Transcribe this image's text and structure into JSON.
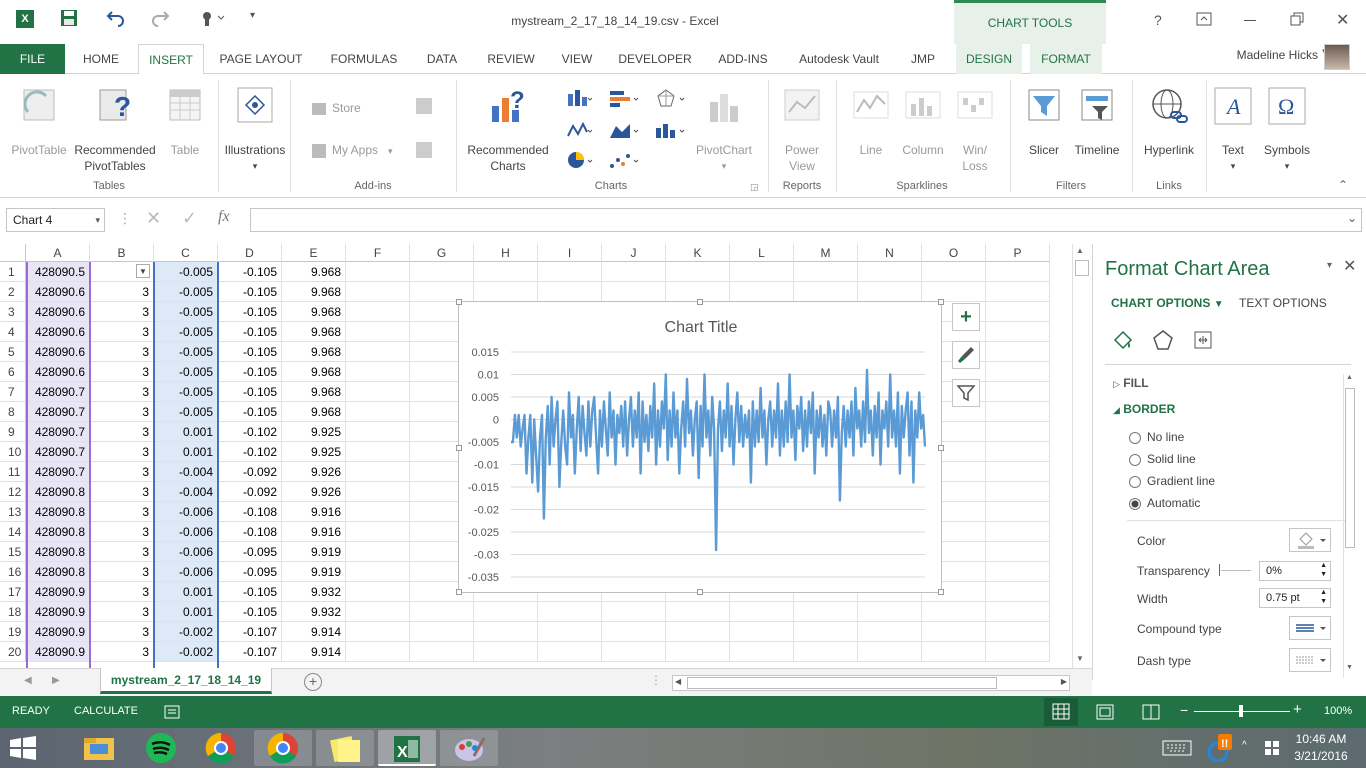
{
  "window": {
    "title": "mystream_2_17_18_14_19.csv - Excel",
    "chart_tools_label": "CHART TOOLS",
    "help": "?",
    "user": "Madeline Hicks"
  },
  "tabs": [
    "FILE",
    "HOME",
    "INSERT",
    "PAGE LAYOUT",
    "FORMULAS",
    "DATA",
    "REVIEW",
    "VIEW",
    "DEVELOPER",
    "ADD-INS",
    "Autodesk Vault",
    "JMP",
    "DESIGN",
    "FORMAT"
  ],
  "ribbon": {
    "pivottable": "PivotTable",
    "rec_pivot_1": "Recommended",
    "rec_pivot_2": "PivotTables",
    "table": "Table",
    "illustrations": "Illustrations",
    "store": "Store",
    "my_apps": "My Apps",
    "rec_charts_1": "Recommended",
    "rec_charts_2": "Charts",
    "pivotchart": "PivotChart",
    "power_view_1": "Power",
    "power_view_2": "View",
    "line": "Line",
    "column": "Column",
    "winloss_1": "Win/",
    "winloss_2": "Loss",
    "slicer": "Slicer",
    "timeline": "Timeline",
    "hyperlink": "Hyperlink",
    "text": "Text",
    "symbols": "Symbols",
    "groups": {
      "tables": "Tables",
      "addins": "Add-ins",
      "charts": "Charts",
      "reports": "Reports",
      "sparklines": "Sparklines",
      "filters": "Filters",
      "links": "Links"
    }
  },
  "formula_bar": {
    "name_box": "Chart 4",
    "fx": "fx",
    "value": ""
  },
  "columns": [
    "A",
    "B",
    "C",
    "D",
    "E",
    "F",
    "G",
    "H",
    "I",
    "J",
    "K",
    "L",
    "M",
    "N",
    "O",
    "P"
  ],
  "rows": [
    {
      "n": "1",
      "a": "428090.5",
      "b": "",
      "c": "-0.005",
      "d": "-0.105",
      "e": "9.968"
    },
    {
      "n": "2",
      "a": "428090.6",
      "b": "3",
      "c": "-0.005",
      "d": "-0.105",
      "e": "9.968"
    },
    {
      "n": "3",
      "a": "428090.6",
      "b": "3",
      "c": "-0.005",
      "d": "-0.105",
      "e": "9.968"
    },
    {
      "n": "4",
      "a": "428090.6",
      "b": "3",
      "c": "-0.005",
      "d": "-0.105",
      "e": "9.968"
    },
    {
      "n": "5",
      "a": "428090.6",
      "b": "3",
      "c": "-0.005",
      "d": "-0.105",
      "e": "9.968"
    },
    {
      "n": "6",
      "a": "428090.6",
      "b": "3",
      "c": "-0.005",
      "d": "-0.105",
      "e": "9.968"
    },
    {
      "n": "7",
      "a": "428090.7",
      "b": "3",
      "c": "-0.005",
      "d": "-0.105",
      "e": "9.968"
    },
    {
      "n": "8",
      "a": "428090.7",
      "b": "3",
      "c": "-0.005",
      "d": "-0.105",
      "e": "9.968"
    },
    {
      "n": "9",
      "a": "428090.7",
      "b": "3",
      "c": "0.001",
      "d": "-0.102",
      "e": "9.925"
    },
    {
      "n": "10",
      "a": "428090.7",
      "b": "3",
      "c": "0.001",
      "d": "-0.102",
      "e": "9.925"
    },
    {
      "n": "11",
      "a": "428090.7",
      "b": "3",
      "c": "-0.004",
      "d": "-0.092",
      "e": "9.926"
    },
    {
      "n": "12",
      "a": "428090.8",
      "b": "3",
      "c": "-0.004",
      "d": "-0.092",
      "e": "9.926"
    },
    {
      "n": "13",
      "a": "428090.8",
      "b": "3",
      "c": "-0.006",
      "d": "-0.108",
      "e": "9.916"
    },
    {
      "n": "14",
      "a": "428090.8",
      "b": "3",
      "c": "-0.006",
      "d": "-0.108",
      "e": "9.916"
    },
    {
      "n": "15",
      "a": "428090.8",
      "b": "3",
      "c": "-0.006",
      "d": "-0.095",
      "e": "9.919"
    },
    {
      "n": "16",
      "a": "428090.8",
      "b": "3",
      "c": "-0.006",
      "d": "-0.095",
      "e": "9.919"
    },
    {
      "n": "17",
      "a": "428090.9",
      "b": "3",
      "c": "0.001",
      "d": "-0.105",
      "e": "9.932"
    },
    {
      "n": "18",
      "a": "428090.9",
      "b": "3",
      "c": "0.001",
      "d": "-0.105",
      "e": "9.932"
    },
    {
      "n": "19",
      "a": "428090.9",
      "b": "3",
      "c": "-0.002",
      "d": "-0.107",
      "e": "9.914"
    },
    {
      "n": "20",
      "a": "428090.9",
      "b": "3",
      "c": "-0.002",
      "d": "-0.107",
      "e": "9.914"
    }
  ],
  "chart_data": {
    "type": "line",
    "title": "Chart Title",
    "ylim": [
      -0.035,
      0.015
    ],
    "yticks": [
      "0.015",
      "0.01",
      "0.005",
      "0",
      "-0.005",
      "-0.01",
      "-0.015",
      "-0.02",
      "-0.025",
      "-0.03",
      "-0.035"
    ],
    "grid": true,
    "legend": "none",
    "color": "#5b9bd5",
    "series": [
      {
        "values": [
          -0.005,
          -0.005,
          0.001,
          -0.004,
          0.001,
          -0.006,
          -0.002,
          0.001,
          -0.012,
          -0.004,
          0.001,
          -0.014,
          0.0,
          -0.008,
          -0.016,
          -0.004,
          0.001,
          -0.022,
          -0.004,
          0.003,
          -0.01,
          0.005,
          -0.006,
          0.0,
          0.004,
          -0.015,
          -0.005,
          0.002,
          -0.006,
          -0.01,
          0.006,
          -0.004,
          0.001,
          -0.012,
          -0.002,
          0.005,
          -0.007,
          0.003,
          -0.003,
          -0.008,
          0.004,
          -0.006,
          0.002,
          0.005,
          -0.004,
          -0.012,
          0.002,
          -0.006,
          0.004,
          -0.002,
          -0.008,
          0.006,
          -0.004,
          0.002,
          -0.01,
          0.001,
          -0.003,
          0.003,
          -0.006,
          0.004,
          -0.008,
          0.0,
          0.005,
          -0.006,
          0.002,
          -0.004,
          0.006,
          -0.012,
          0.004,
          -0.005,
          0.001,
          -0.007,
          0.003,
          -0.004,
          0.008,
          -0.01,
          0.002,
          -0.006,
          0.004,
          -0.002,
          0.01,
          -0.009,
          0.002,
          -0.006,
          0.006,
          -0.004,
          0.002,
          -0.012,
          -0.002,
          0.004,
          -0.006,
          0.009,
          -0.003,
          0.002,
          -0.008,
          0.0,
          0.004,
          -0.013,
          0.003,
          -0.006,
          0.01,
          -0.004,
          0.002,
          -0.008,
          0.005,
          -0.002,
          -0.029,
          -0.002,
          0.004,
          -0.007,
          0.002,
          -0.004,
          0.008,
          -0.006,
          0.003,
          -0.01,
          0.0,
          0.006,
          -0.005,
          0.003,
          -0.006,
          0.001,
          -0.004,
          0.002,
          -0.014,
          0.004,
          -0.006,
          0.002,
          -0.005,
          0.007,
          -0.004,
          0.002,
          -0.01,
          0.0,
          0.004,
          -0.006,
          0.002,
          -0.004,
          0.008,
          -0.008,
          0.002,
          -0.006,
          0.004,
          -0.005,
          0.01,
          -0.004,
          0.002,
          -0.009,
          0.003,
          -0.002,
          0.005,
          -0.007,
          0.002,
          -0.006,
          0.004,
          -0.003,
          0.006,
          -0.012,
          0.002,
          -0.004,
          0.003,
          -0.006,
          0.001,
          -0.008,
          0.004,
          0.002,
          -0.006,
          0.002,
          -0.004,
          0.005,
          -0.018,
          -0.003,
          0.003,
          -0.006,
          0.002,
          -0.004,
          0.004,
          -0.008,
          0.007,
          -0.002,
          0.002,
          -0.006,
          0.004,
          -0.005,
          0.011,
          -0.003,
          0.002,
          -0.008,
          0.003,
          -0.004,
          0.006,
          -0.01,
          0.002,
          -0.002,
          0.004,
          -0.006,
          0.01,
          -0.004,
          0.002,
          -0.006,
          0.006,
          -0.012,
          0.003,
          -0.004,
          0.002,
          0.006,
          -0.008,
          0.004,
          -0.014,
          0.002,
          -0.004,
          0.006,
          -0.002,
          0.001,
          -0.006
        ]
      }
    ]
  },
  "side_pane": {
    "title": "Format Chart Area",
    "chart_options": "CHART OPTIONS",
    "text_options": "TEXT OPTIONS",
    "fill": "FILL",
    "border": "BORDER",
    "radio": [
      "No line",
      "Solid line",
      "Gradient line",
      "Automatic"
    ],
    "color_label": "Color",
    "transparency_label": "Transparency",
    "transparency_value": "0%",
    "width_label": "Width",
    "width_value": "0.75 pt",
    "compound_label": "Compound type",
    "dash_label": "Dash type"
  },
  "sheet_tab": "mystream_2_17_18_14_19",
  "status": {
    "ready": "READY",
    "calculate": "CALCULATE",
    "zoom": "100%"
  },
  "taskbar": {
    "time": "10:46 AM",
    "date": "3/21/2016"
  }
}
